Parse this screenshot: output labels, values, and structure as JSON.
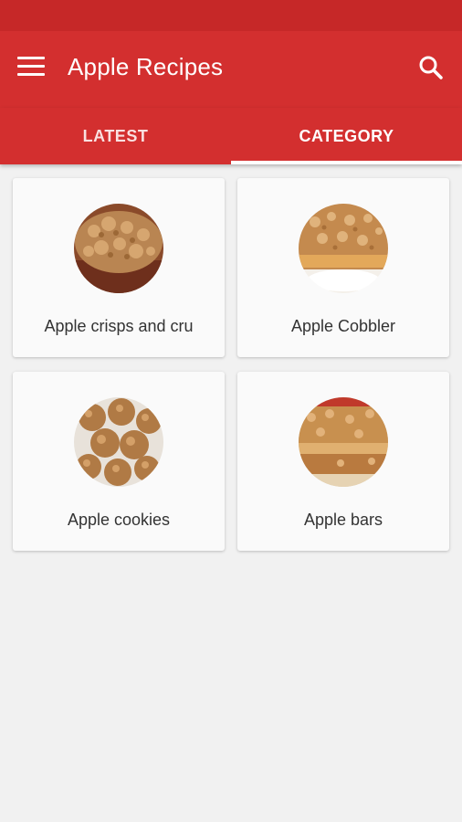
{
  "app": {
    "title": "Apple Recipes",
    "menu_icon": "hamburger-menu-icon",
    "search_icon": "search-icon"
  },
  "tabs": [
    {
      "label": "LATEST",
      "active": false
    },
    {
      "label": "CATEGORY",
      "active": true
    }
  ],
  "categories": [
    {
      "label": "Apple crisps and cru",
      "image": "apple-crisp-photo"
    },
    {
      "label": "Apple Cobbler",
      "image": "apple-cobbler-photo"
    },
    {
      "label": "Apple cookies",
      "image": "apple-cookies-photo"
    },
    {
      "label": "Apple bars",
      "image": "apple-bars-photo"
    }
  ],
  "colors": {
    "status_bar": "#c62828",
    "app_bar": "#d32f2f",
    "background": "#f1f1f1"
  }
}
